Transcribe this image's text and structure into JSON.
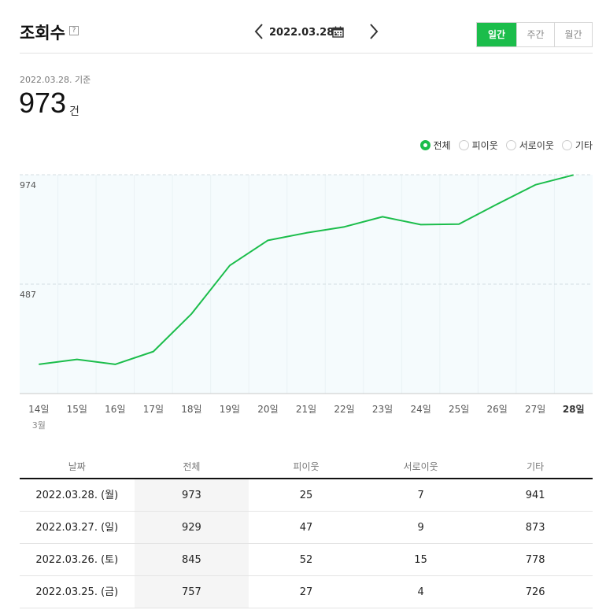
{
  "header": {
    "title": "조회수",
    "help": "?",
    "date": "2022.03.28.",
    "periods": [
      "일간",
      "주간",
      "월간"
    ]
  },
  "summary": {
    "basis": "2022.03.28. 기준",
    "value": "973",
    "unit": "건"
  },
  "legend": [
    "전체",
    "피이웃",
    "서로이웃",
    "기타"
  ],
  "chart_data": {
    "type": "line",
    "categories": [
      "14일",
      "15일",
      "16일",
      "17일",
      "18일",
      "19일",
      "20일",
      "21일",
      "22일",
      "23일",
      "24일",
      "25일",
      "26일",
      "27일",
      "28일"
    ],
    "month_label": "3월",
    "series": [
      {
        "name": "전체",
        "values": [
          130,
          152,
          130,
          187,
          355,
          570,
          682,
          715,
          742,
          787,
          752,
          754,
          843,
          929,
          973
        ]
      }
    ],
    "yticks": [
      "974",
      "487"
    ],
    "ylim": [
      0,
      974
    ],
    "color": "#1bbd4b"
  },
  "table": {
    "headers": [
      "날짜",
      "전체",
      "피이웃",
      "서로이웃",
      "기타"
    ],
    "rows": [
      [
        "2022.03.28. (월)",
        "973",
        "25",
        "7",
        "941"
      ],
      [
        "2022.03.27. (일)",
        "929",
        "47",
        "9",
        "873"
      ],
      [
        "2022.03.26. (토)",
        "845",
        "52",
        "15",
        "778"
      ],
      [
        "2022.03.25. (금)",
        "757",
        "27",
        "4",
        "726"
      ]
    ]
  }
}
